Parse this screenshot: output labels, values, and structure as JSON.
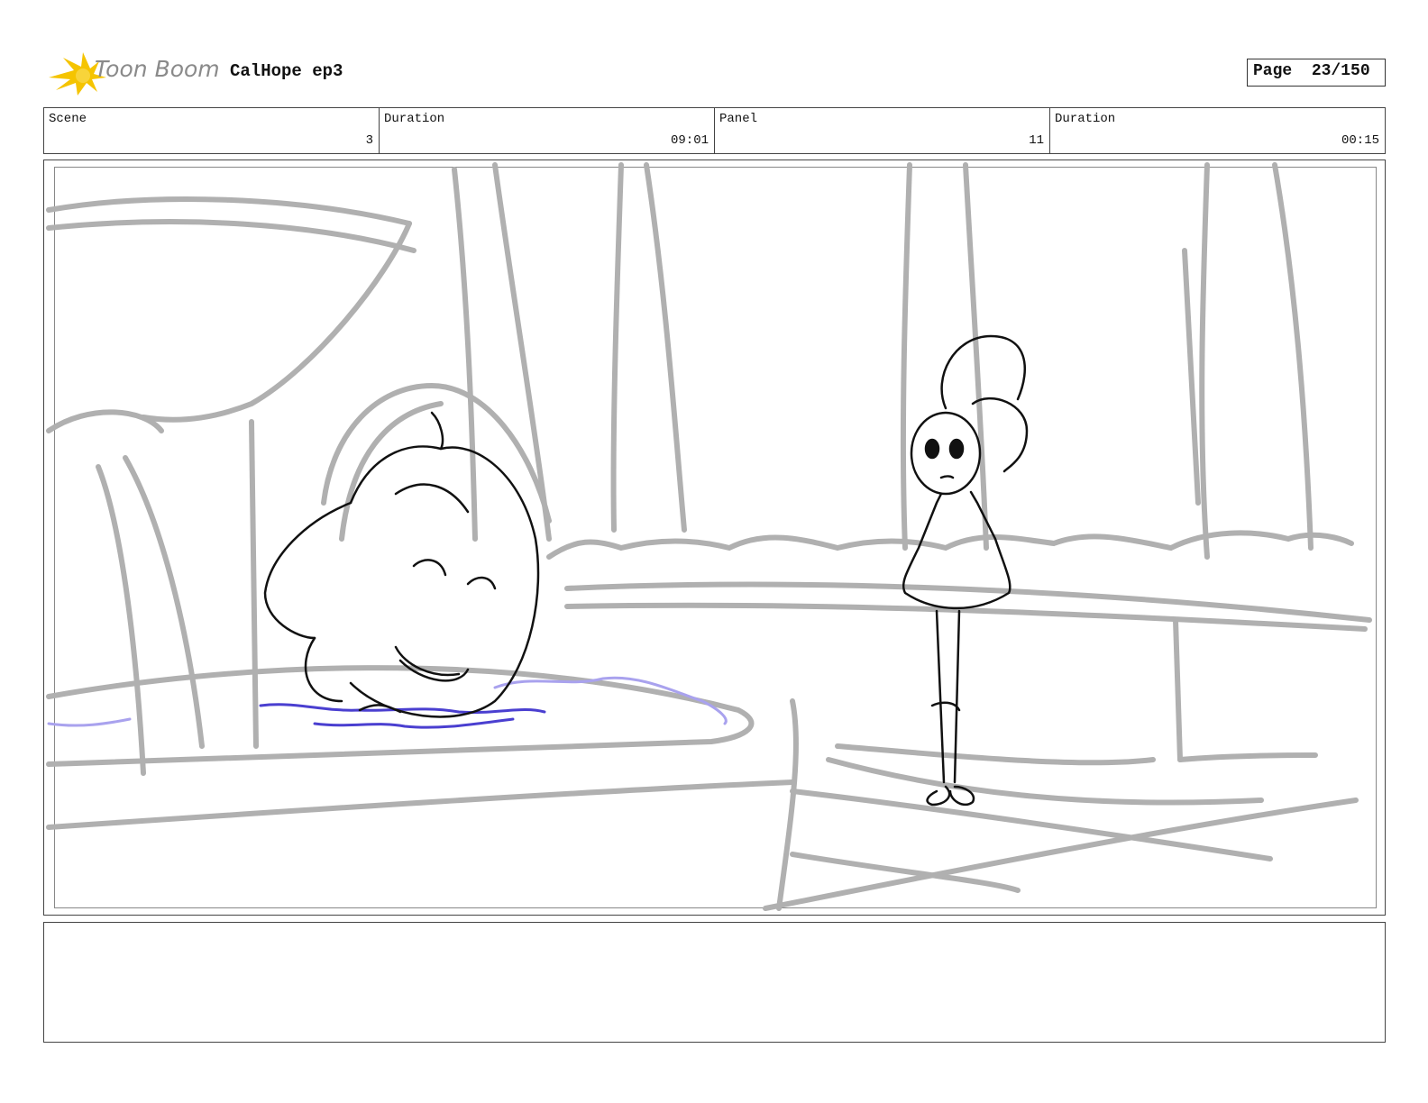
{
  "header": {
    "brand": "Toon Boom",
    "project_title": "CalHope ep3",
    "page_label": "Page",
    "page_number": "23/150"
  },
  "info_row": {
    "scene_label": "Scene",
    "scene_value": "3",
    "scene_duration_label": "Duration",
    "scene_duration_value": "09:01",
    "panel_label": "Panel",
    "panel_value": "11",
    "panel_duration_label": "Duration",
    "panel_duration_value": "00:15"
  },
  "notes": {
    "text": ""
  },
  "colors": {
    "sketch_gray": "#b0b0b0",
    "line_black": "#111111",
    "water_blue": "#4a3fd0",
    "water_light": "#a9a2ee",
    "logo_yellow": "#f5c400"
  },
  "icons": {
    "logo": "toon-boom-starburst-logo"
  }
}
